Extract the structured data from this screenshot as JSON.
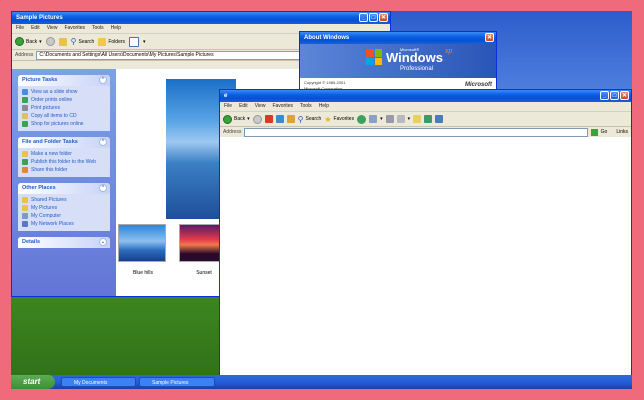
{
  "explorer": {
    "title": "Sample Pictures",
    "menu": [
      "File",
      "Edit",
      "View",
      "Favorites",
      "Tools",
      "Help"
    ],
    "toolbar": {
      "back": "Back",
      "search": "Search",
      "folders": "Folders"
    },
    "address_label": "Address",
    "address_value": "C:\\Documents and Settings\\All Users\\Documents\\My Pictures\\Sample Pictures",
    "picture_tasks": {
      "title": "Picture Tasks",
      "items": [
        "View as a slide show",
        "Order prints online",
        "Print pictures",
        "Copy all items to CD",
        "Shop for pictures online"
      ]
    },
    "file_tasks": {
      "title": "File and Folder Tasks",
      "items": [
        "Make a new folder",
        "Publish this folder to the Web",
        "Share this folder"
      ]
    },
    "other_places": {
      "title": "Other Places",
      "items": [
        "Shared Pictures",
        "My Pictures",
        "My Computer",
        "My Network Places"
      ]
    },
    "details": {
      "title": "Details"
    },
    "thumbs": [
      {
        "label": "Blue hills"
      },
      {
        "label": "Sunset"
      }
    ]
  },
  "about": {
    "title": "About Windows",
    "brand": "Windows",
    "xp": "xp",
    "edition": "Professional",
    "ms_small": "Microsoft®",
    "microsoft": "Microsoft",
    "copyright": "Copyright © 1985-2001",
    "corporation": "Microsoft Corporation",
    "partial": "Microsoft ® Windows"
  },
  "ie": {
    "menu": [
      "File",
      "Edit",
      "View",
      "Favorites",
      "Tools",
      "Help"
    ],
    "toolbar": {
      "back": "Back",
      "search": "Search",
      "favorites": "Favorites"
    },
    "address_label": "Address",
    "go": "Go",
    "links": "Links"
  },
  "taskbar": {
    "start": "start",
    "items": [
      "My Documents",
      "Sample Pictures"
    ]
  }
}
